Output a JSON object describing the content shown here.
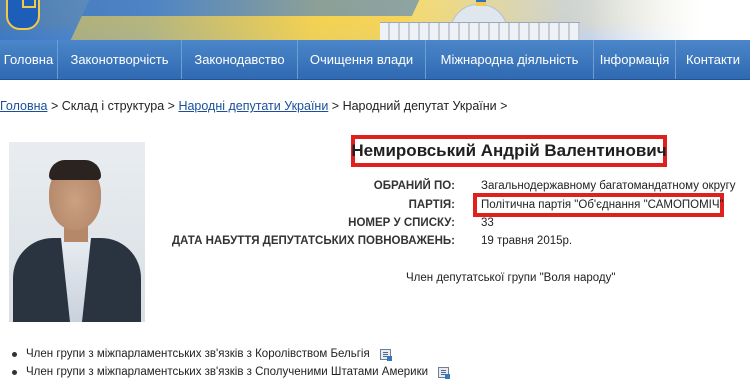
{
  "nav": {
    "items": [
      {
        "label": "Головна"
      },
      {
        "label": "Законотворчість"
      },
      {
        "label": "Законодавство"
      },
      {
        "label": "Очищення влади"
      },
      {
        "label": "Міжнародна діяльність"
      },
      {
        "label": "Інформація"
      },
      {
        "label": "Контакти"
      }
    ]
  },
  "breadcrumb": {
    "home": "Головна",
    "sep1": " > ",
    "structure": "Склад і структура",
    "sep2": " > ",
    "deputies": "Народні депутати України",
    "sep3": " > ",
    "current": "Народний депутат України",
    "sep4": " >"
  },
  "deputy": {
    "name": "Немировський Андрій Валентинович",
    "elected_label": "ОБРАНИЙ ПО:",
    "elected_value": "Загальнодержавному багатомандатному округу",
    "party_label": "ПАРТІЯ:",
    "party_value": "Політична партія \"Об'єднання \"САМОПОМІЧ\"",
    "list_number_label": "НОМЕР У СПИСКУ:",
    "list_number_value": "33",
    "term_start_label": "ДАТА НАБУТТЯ ДЕПУТАТСЬКИХ ПОВНОВАЖЕНЬ:",
    "term_start_value": "19 травня 2015р.",
    "faction": "Член депутатської групи \"Воля народу\""
  },
  "groups": [
    {
      "label": "Член групи з міжпарламентських зв'язків з Королівством Бельгія",
      "icon": "document-icon"
    },
    {
      "label": "Член групи з міжпарламентських зв'язків з Сполученими Штатами Америки",
      "icon": "document-icon"
    }
  ],
  "colors": {
    "nav_blue": "#2f6ab2",
    "highlight_red": "#e0201d",
    "link_blue": "#1a4f9c"
  }
}
